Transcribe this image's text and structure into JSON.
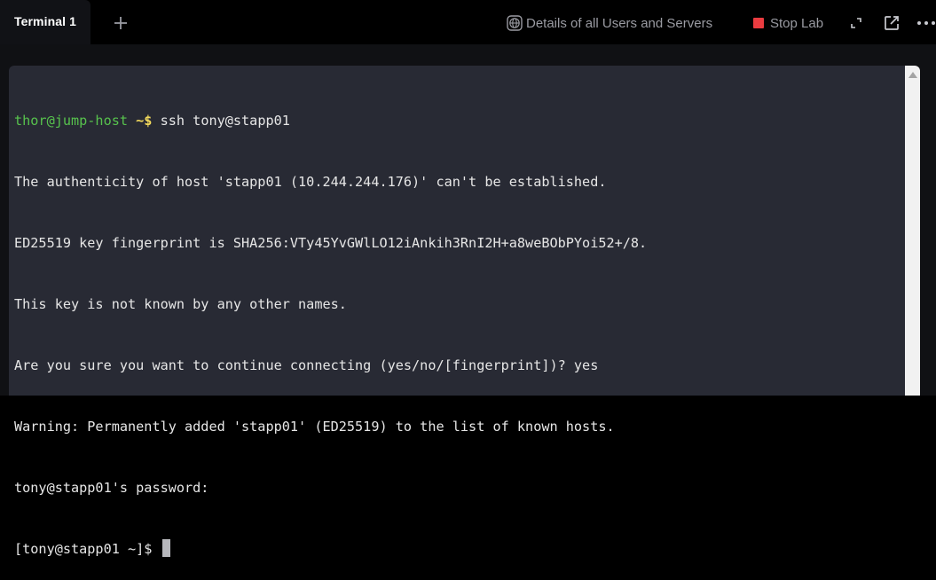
{
  "tabs": [
    {
      "label": "Terminal 1",
      "active": true
    }
  ],
  "header": {
    "add_tab_icon": "plus-icon",
    "details_label": "Details of all Users and Servers",
    "details_icon": "globe-icon",
    "stop_label": "Stop Lab",
    "stop_color": "#ea3c40",
    "expand_icon": "expand-icon",
    "open_external_icon": "open-external-icon",
    "more_icon": "more-horizontal-icon"
  },
  "terminal": {
    "prompt_user_host": "thor@jump-host",
    "prompt_path_symbol": " ~$",
    "command": " ssh tony@stapp01",
    "output_lines": [
      "The authenticity of host 'stapp01 (10.244.244.176)' can't be established.",
      "ED25519 key fingerprint is SHA256:VTy45YvGWlLO12iAnkih3RnI2H+a8weBObPYoi52+/8.",
      "This key is not known by any other names.",
      "Are you sure you want to continue connecting (yes/no/[fingerprint])? yes",
      "Warning: Permanently added 'stapp01' (ED25519) to the list of known hosts.",
      "tony@stapp01's password:"
    ],
    "current_prompt": "[tony@stapp01 ~]$ ",
    "colors": {
      "background": "#282a34",
      "text": "#e6e6e6",
      "prompt_green": "#57c24d",
      "prompt_yellow": "#f2d95c"
    }
  }
}
